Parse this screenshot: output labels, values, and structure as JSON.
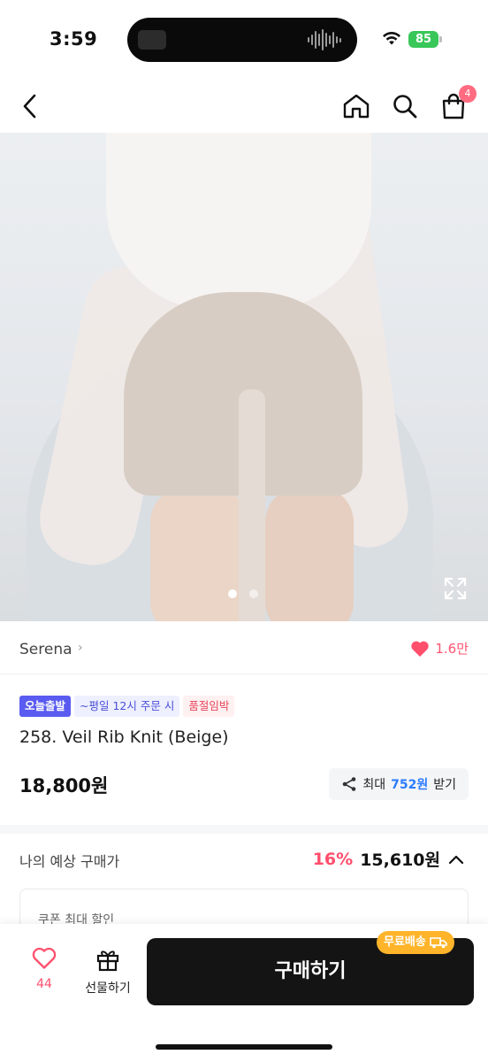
{
  "status_bar": {
    "time": "3:59",
    "battery": "85"
  },
  "nav": {
    "cart_count": "4"
  },
  "gallery": {
    "image_count": 2,
    "active_index": 0
  },
  "brand": {
    "name": "Serena",
    "likes": "1.6만"
  },
  "tags": [
    {
      "label": "오늘출발"
    },
    {
      "label": "~평일 12시 주문 시"
    },
    {
      "label": "품절임박"
    }
  ],
  "product": {
    "title": "258. Veil Rib Knit (Beige)",
    "price": "18,800원",
    "reward_prefix": "최대",
    "reward_amount": "752원",
    "reward_suffix": "받기"
  },
  "expected": {
    "label": "나의 예상 구매가",
    "discount_rate": "16%",
    "price": "15,610원"
  },
  "coupon": {
    "label": "쿠폰 최대 할인"
  },
  "bottom_bar": {
    "wish_count": "44",
    "gift_label": "선물하기",
    "buy_label": "구매하기",
    "free_shipping": "무료배송"
  },
  "colors": {
    "accent_pink": "#ff4f6d",
    "tag_blue": "#5a5bf0",
    "reward_blue": "#2b7bff",
    "free_badge": "#ffb42a",
    "buy_button": "#141414"
  }
}
